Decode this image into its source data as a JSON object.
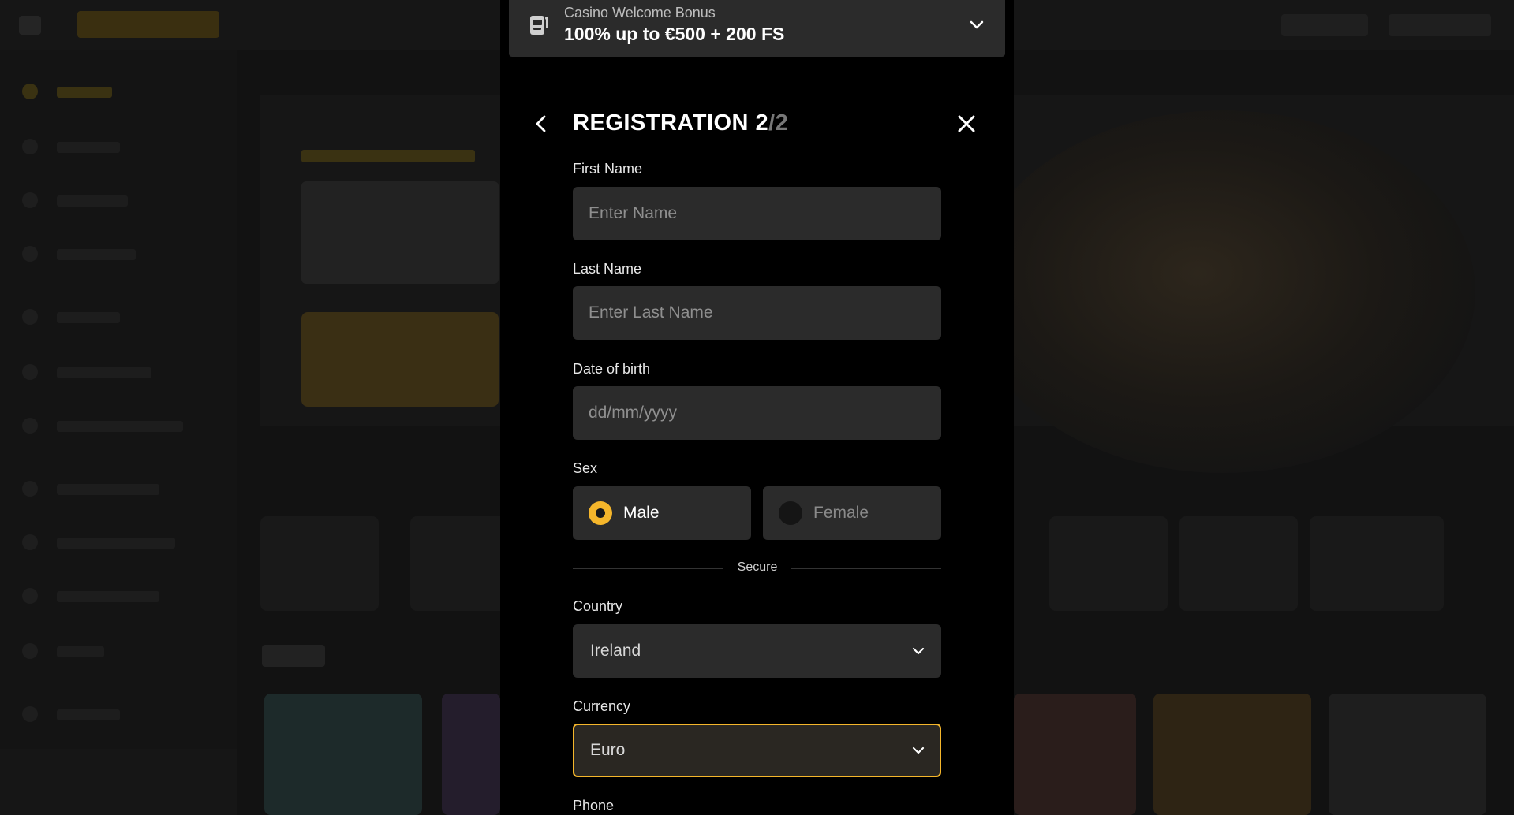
{
  "bonus": {
    "subtitle": "Casino Welcome Bonus",
    "title": "100% up to €500 + 200 FS"
  },
  "registration": {
    "title_main": "REGISTRATION 2",
    "title_step": "/2"
  },
  "form": {
    "first_name": {
      "label": "First Name",
      "placeholder": "Enter Name"
    },
    "last_name": {
      "label": "Last Name",
      "placeholder": "Enter Last Name"
    },
    "dob": {
      "label": "Date of birth",
      "placeholder": "dd/mm/yyyy"
    },
    "sex": {
      "label": "Sex",
      "options": [
        {
          "label": "Male",
          "selected": true
        },
        {
          "label": "Female",
          "selected": false
        }
      ]
    },
    "divider": "Secure",
    "country": {
      "label": "Country",
      "value": "Ireland"
    },
    "currency": {
      "label": "Currency",
      "value": "Euro"
    },
    "phone": {
      "label": "Phone"
    }
  },
  "colors": {
    "accent": "#f5b62b",
    "modal_bg": "#000000",
    "field_bg": "#2b2b2b",
    "bonus_bar_bg": "#2b2b2b"
  },
  "icons": {
    "bonus": "slot-machine-icon",
    "back": "chevron-left-icon",
    "close": "close-icon",
    "dropdown": "chevron-down-icon"
  }
}
